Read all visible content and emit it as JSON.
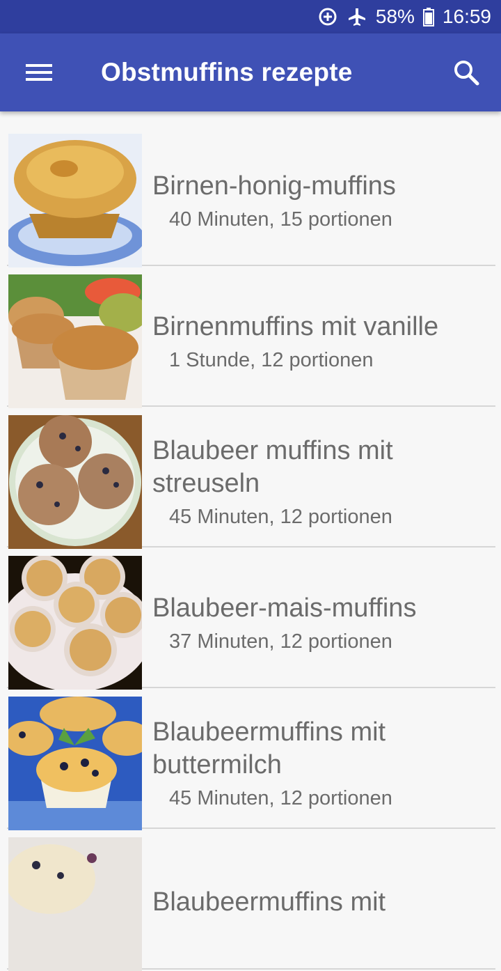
{
  "status": {
    "battery": "58%",
    "time": "16:59"
  },
  "appbar": {
    "title": "Obstmuffins rezepte"
  },
  "recipes": [
    {
      "title": "Birnen-honig-muffins",
      "meta": "40 Minuten, 15 portionen"
    },
    {
      "title": "Birnenmuffins mit vanille",
      "meta": "1 Stunde, 12 portionen"
    },
    {
      "title": "Blaubeer muffins mit streuseln",
      "meta": "45 Minuten, 12 portionen"
    },
    {
      "title": "Blaubeer-mais-muffins",
      "meta": "37 Minuten, 12 portionen"
    },
    {
      "title": "Blaubeermuffins mit buttermilch",
      "meta": "45 Minuten, 12 portionen"
    },
    {
      "title": "Blaubeermuffins mit",
      "meta": ""
    }
  ],
  "colors": {
    "primary": "#3f51b5",
    "primary_dark": "#2f3e9e"
  }
}
